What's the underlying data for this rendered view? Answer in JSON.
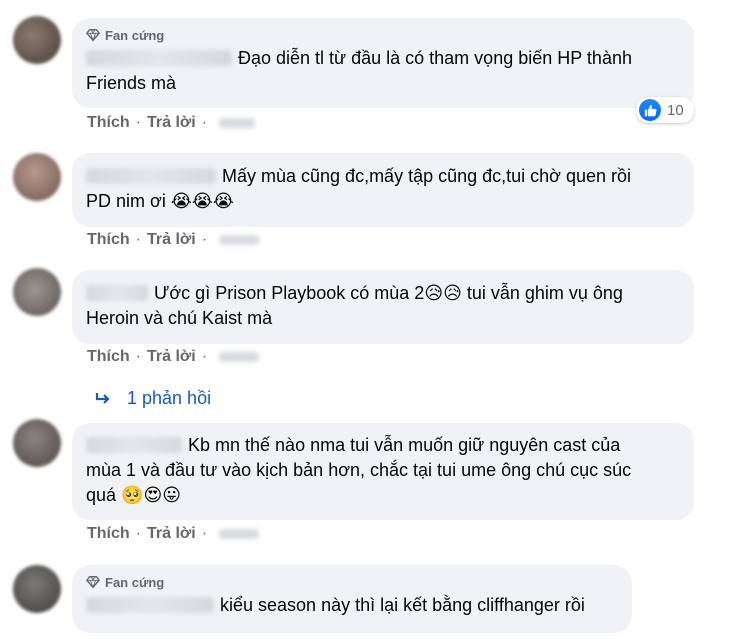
{
  "badge_label": "Fan cứng",
  "like_label": "Thích",
  "reply_label": "Trả lời",
  "separator": "·",
  "colors": {
    "bubble": "#f0f2f5",
    "action": "#65676b",
    "link": "#1a5bb5",
    "like": "#1877f2"
  },
  "comments": [
    {
      "has_badge": true,
      "line1": "Đạo diễn tl từ đầu là có tham vọng biến HP thành",
      "line2": "Friends mà",
      "reaction_count": "10"
    },
    {
      "has_badge": false,
      "line1": "Mấy mùa cũng đc,mấy tập cũng đc,tui chờ quen rồi",
      "line2": "PD nim ơi",
      "emojis": "😭😭😭"
    },
    {
      "has_badge": false,
      "line1a": "Ước gì Prison Playbook có mùa 2",
      "line1_emojis": "😥😥",
      "line1b": " tui vẫn ghim vụ ông",
      "line2": "Heroin và chú Kaist mà",
      "replies": "1 phản hồi"
    },
    {
      "has_badge": false,
      "line1": "Kb mn thế nào nma tui vẫn muốn giữ nguyên cast của",
      "line2": "mùa 1 và đầu tư vào kịch bản hơn, chắc tại tui ume ông chú cục súc",
      "line3": "quá",
      "emojis": "🥺😍😛"
    },
    {
      "has_badge": true,
      "line1": "kiểu season này thì lại kết bằng cliffhanger rồi"
    }
  ]
}
